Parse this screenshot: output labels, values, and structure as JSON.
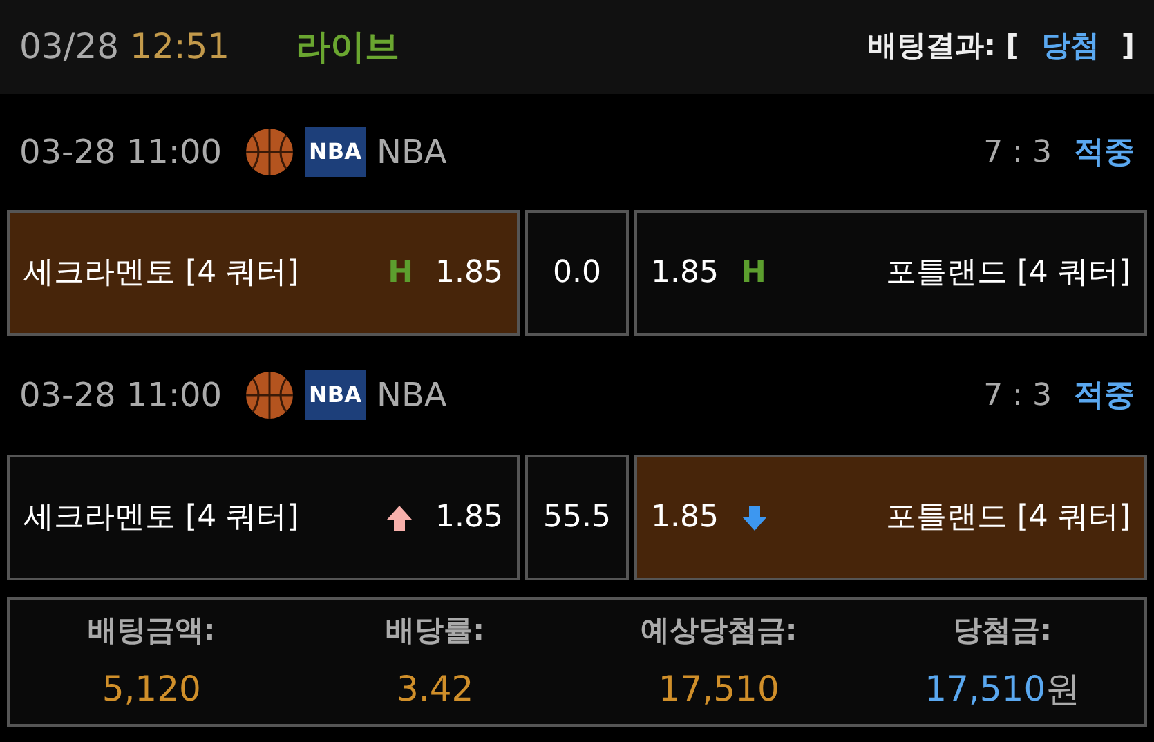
{
  "header": {
    "date": "03/28",
    "time": "12:51",
    "status": "라이브",
    "result_label": "배팅결과: [",
    "result": "당첨",
    "result_close": "]"
  },
  "matches": [
    {
      "datetime": "03-28 11:00",
      "league_logo": "NBA",
      "league": "NBA",
      "score": "7 : 3",
      "outcome": "적중",
      "home": {
        "team": "세크라멘토 [4 쿼터]",
        "odds": "1.85",
        "marker": {
          "kind": "handicap",
          "label": "H"
        },
        "selected": true
      },
      "line": "0.0",
      "away": {
        "team": "포틀랜드 [4 쿼터]",
        "odds": "1.85",
        "marker": {
          "kind": "handicap",
          "label": "H"
        },
        "selected": false
      }
    },
    {
      "datetime": "03-28 11:00",
      "league_logo": "NBA",
      "league": "NBA",
      "score": "7 : 3",
      "outcome": "적중",
      "home": {
        "team": "세크라멘토 [4 쿼터]",
        "odds": "1.85",
        "marker": {
          "kind": "up"
        },
        "selected": false
      },
      "line": "55.5",
      "away": {
        "team": "포틀랜드 [4 쿼터]",
        "odds": "1.85",
        "marker": {
          "kind": "down"
        },
        "selected": true
      }
    }
  ],
  "summary": [
    {
      "label": "배팅금액:",
      "value": "5,120",
      "kind": "amount"
    },
    {
      "label": "배당률:",
      "value": "3.42",
      "kind": "amount"
    },
    {
      "label": "예상당첨금:",
      "value": "17,510",
      "kind": "amount"
    },
    {
      "label": "당첨금:",
      "value": "17,510",
      "unit": "원",
      "kind": "win"
    }
  ]
}
